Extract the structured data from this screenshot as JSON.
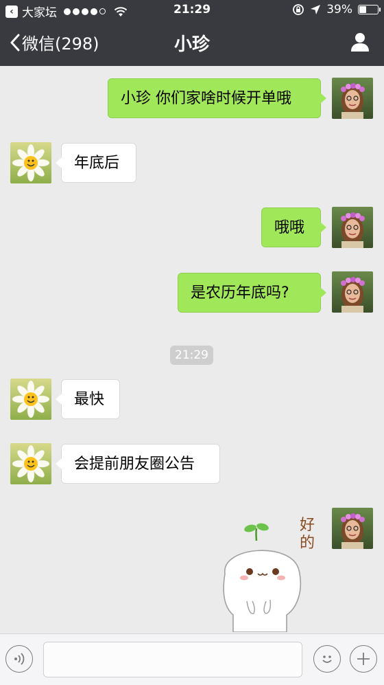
{
  "status_bar": {
    "carrier": "大家坛",
    "time": "21:29",
    "battery": "39%"
  },
  "nav": {
    "back_label": "微信(298)",
    "title": "小珍"
  },
  "messages": [
    {
      "direction": "out",
      "text": "小珍 你们家啥时候开单哦"
    },
    {
      "direction": "in",
      "text": "年底后"
    },
    {
      "direction": "out",
      "text": "哦哦"
    },
    {
      "direction": "out",
      "text": "是农历年底吗?"
    },
    {
      "direction": "in",
      "text": "最快"
    },
    {
      "direction": "in",
      "text": "会提前朋友圈公告"
    }
  ],
  "timestamp_divider": "21:29",
  "sticker": {
    "text_line1": "好",
    "text_line2": "的"
  },
  "colors": {
    "nav_bg": "#393a3f",
    "chat_bg": "#ebebeb",
    "bubble_out": "#a0e75a",
    "bubble_in": "#ffffff"
  }
}
